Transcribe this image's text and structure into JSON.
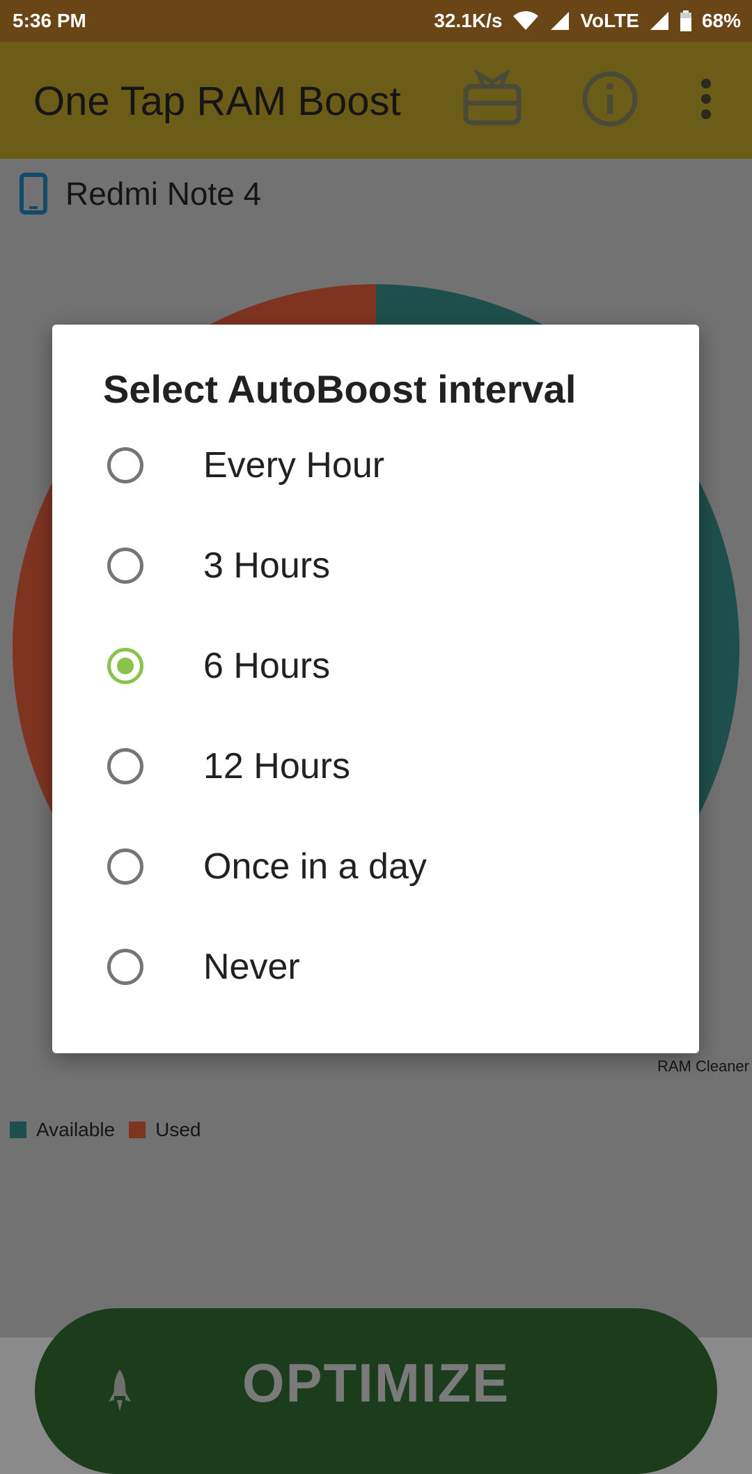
{
  "status_bar": {
    "time": "5:36 PM",
    "speed": "32.1K/s",
    "network": "VoLTE",
    "battery": "68%"
  },
  "app_bar": {
    "title": "One Tap RAM Boost",
    "icons": [
      "gift-icon",
      "info-icon",
      "more-vert-icon"
    ]
  },
  "device": {
    "name": "Redmi Note 4",
    "icon": "phone-icon"
  },
  "chart_data": {
    "type": "pie",
    "series": [
      {
        "name": "Available",
        "value": 35,
        "color": "#1f6b66"
      },
      {
        "name": "Used",
        "value": 65,
        "color": "#b0422a"
      }
    ]
  },
  "chart_caption": "RAM Cleaner",
  "legend": {
    "available_label": "Available",
    "used_label": "Used",
    "available_color": "#1f6b66",
    "used_color": "#b0422a"
  },
  "optimize_button": {
    "label": "OPTIMIZE",
    "icon": "rocket-icon"
  },
  "dialog": {
    "title": "Select AutoBoost interval",
    "options": [
      {
        "label": "Every Hour",
        "selected": false
      },
      {
        "label": "3 Hours",
        "selected": false
      },
      {
        "label": "6 Hours",
        "selected": true
      },
      {
        "label": "12 Hours",
        "selected": false
      },
      {
        "label": "Once in a day",
        "selected": false
      },
      {
        "label": "Never",
        "selected": false
      }
    ],
    "accent_color": "#8bc34a"
  }
}
